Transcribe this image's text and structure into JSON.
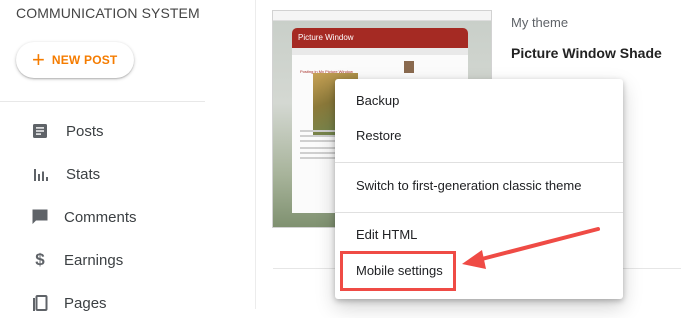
{
  "app": {
    "title": "COMMUNICATION SYSTEM"
  },
  "new_post": {
    "label": "NEW POST",
    "icon": "plus-icon"
  },
  "nav": {
    "items": [
      {
        "label": "Posts",
        "icon": "posts-icon"
      },
      {
        "label": "Stats",
        "icon": "stats-icon"
      },
      {
        "label": "Comments",
        "icon": "comments-icon"
      },
      {
        "label": "Earnings",
        "icon": "dollar-icon"
      },
      {
        "label": "Pages",
        "icon": "pages-icon"
      }
    ]
  },
  "theme": {
    "section_label": "My theme",
    "name": "Picture Window Shade",
    "preview": {
      "blog_title": "Picture Window",
      "post_title": "Posting in My Picture Window"
    }
  },
  "menu": {
    "items": [
      {
        "label": "Backup"
      },
      {
        "label": "Restore"
      },
      {
        "label": "Switch to first-generation classic theme"
      },
      {
        "label": "Edit HTML"
      },
      {
        "label": "Mobile settings"
      }
    ]
  },
  "colors": {
    "accent_orange": "#f57c00",
    "annotation_red": "#ef4b45",
    "theme_header_red": "#a52a23"
  }
}
